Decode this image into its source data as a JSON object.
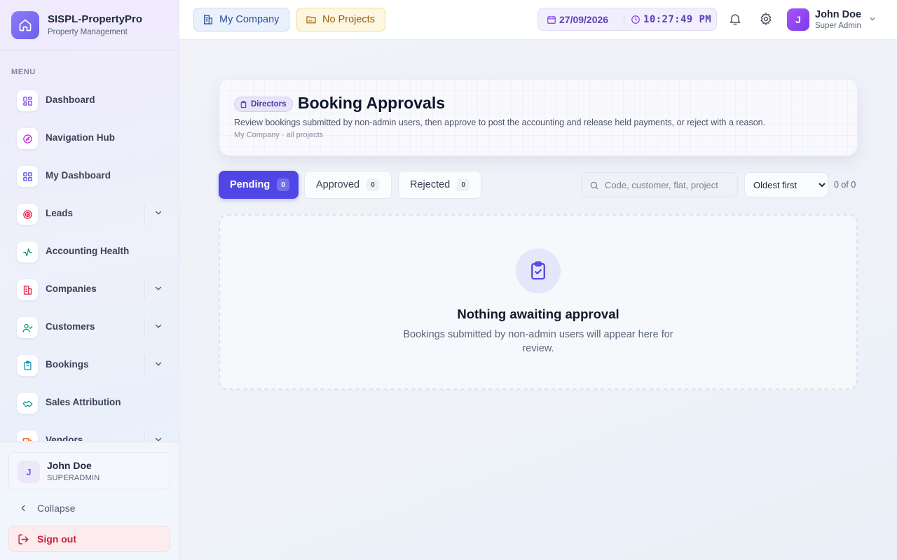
{
  "brand": {
    "name": "SISPL-PropertyPro",
    "subtitle": "Property Management"
  },
  "sidebar": {
    "menu_label": "MENU",
    "items": [
      {
        "label": "Dashboard",
        "icon": "grid-icon",
        "color": "#7c3aed",
        "has_children": false
      },
      {
        "label": "Navigation Hub",
        "icon": "compass-icon",
        "color": "#c026d3",
        "has_children": false
      },
      {
        "label": "My Dashboard",
        "icon": "grid-icon",
        "color": "#4f46e5",
        "has_children": false
      },
      {
        "label": "Leads",
        "icon": "target-icon",
        "color": "#e11d48",
        "has_children": true
      },
      {
        "label": "Accounting Health",
        "icon": "activity-icon",
        "color": "#059669",
        "has_children": false
      },
      {
        "label": "Companies",
        "icon": "building-icon",
        "color": "#e11d48",
        "has_children": true
      },
      {
        "label": "Customers",
        "icon": "user-check-icon",
        "color": "#059669",
        "has_children": true
      },
      {
        "label": "Bookings",
        "icon": "clipboard-icon",
        "color": "#0891b2",
        "has_children": true
      },
      {
        "label": "Sales Attribution",
        "icon": "handshake-icon",
        "color": "#0d9488",
        "has_children": false
      },
      {
        "label": "Vendors",
        "icon": "truck-icon",
        "color": "#ea580c",
        "has_children": true
      }
    ],
    "user": {
      "initial": "J",
      "name": "John Doe",
      "role": "SUPERADMIN"
    },
    "collapse_label": "Collapse",
    "signout_label": "Sign out"
  },
  "topbar": {
    "company_label": "My Company",
    "projects_label": "No Projects",
    "date": "27/09/2026",
    "time": "10:27:49 PM",
    "user": {
      "initial": "J",
      "name": "John Doe",
      "role": "Super Admin"
    }
  },
  "page": {
    "badge": "Directors",
    "title": "Booking Approvals",
    "description": "Review bookings submitted by non-admin users, then approve to post the accounting and release held payments, or reject with a reason.",
    "scope": "My Company · all projects"
  },
  "tabs": [
    {
      "label": "Pending",
      "count": "0",
      "active": true
    },
    {
      "label": "Approved",
      "count": "0",
      "active": false
    },
    {
      "label": "Rejected",
      "count": "0",
      "active": false
    }
  ],
  "filters": {
    "search_placeholder": "Code, customer, flat, project",
    "search_value": "",
    "sort_selected": "Oldest first",
    "result_count": "0 of 0"
  },
  "empty_state": {
    "title": "Nothing awaiting approval",
    "description": "Bookings submitted by non-admin users will appear here for review."
  },
  "colors": {
    "accent": "#4f46e5",
    "danger": "#c81e3d"
  }
}
